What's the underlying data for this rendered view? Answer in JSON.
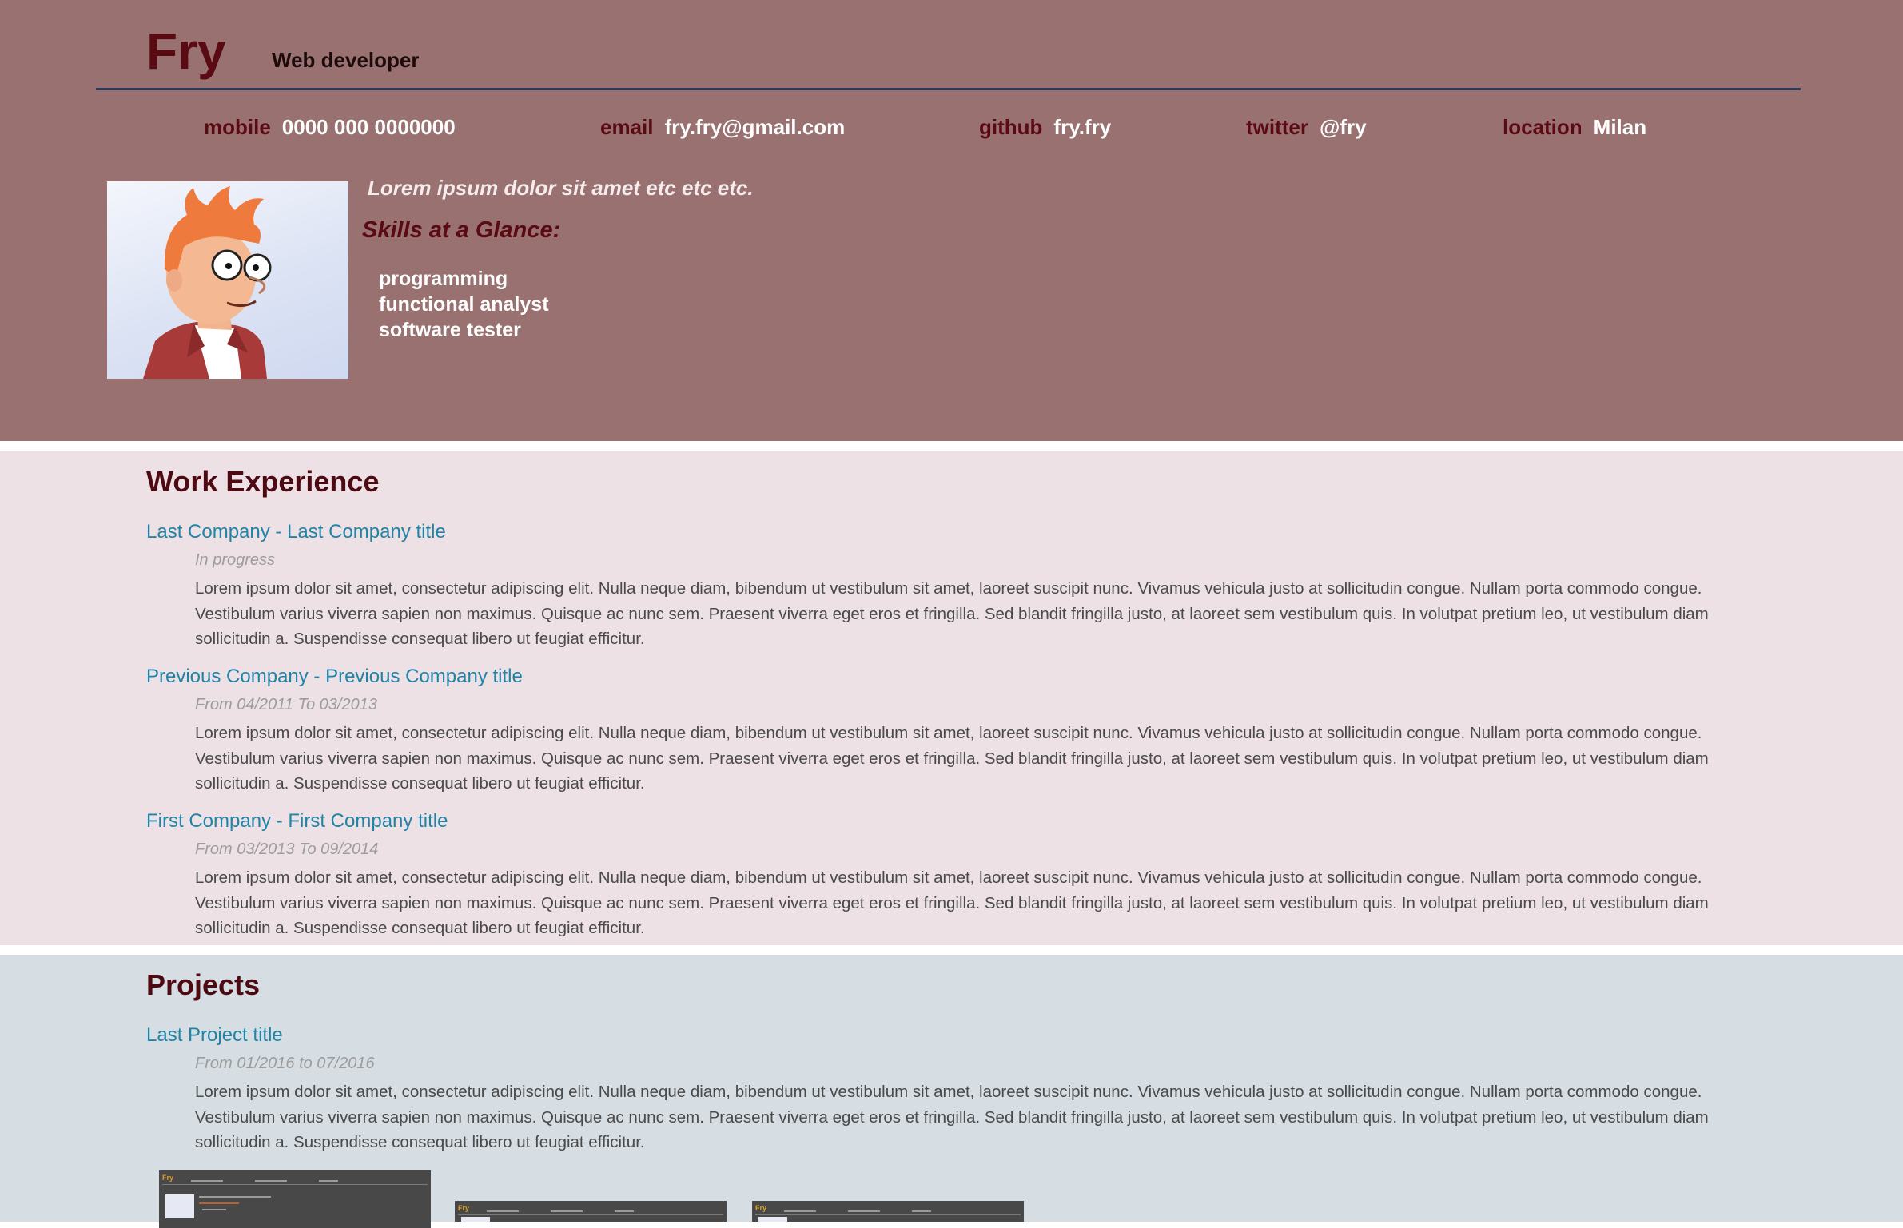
{
  "header": {
    "name": "Fry",
    "role": "Web developer",
    "contacts": [
      {
        "label": "mobile",
        "value": "0000 000 0000000"
      },
      {
        "label": "email",
        "value": "fry.fry@gmail.com"
      },
      {
        "label": "github",
        "value": "fry.fry"
      },
      {
        "label": "twitter",
        "value": "@fry"
      },
      {
        "label": "location",
        "value": "Milan"
      }
    ],
    "tagline": "Lorem ipsum dolor sit amet etc etc etc.",
    "skills_title": "Skills at a Glance:",
    "skills": [
      "programming",
      "functional analyst",
      "software tester"
    ]
  },
  "work": {
    "title": "Work Experience",
    "entries": [
      {
        "title": "Last Company - Last Company title",
        "date": "In progress",
        "description": "Lorem ipsum dolor sit amet, consectetur adipiscing elit. Nulla neque diam, bibendum ut vestibulum sit amet, laoreet suscipit nunc. Vivamus vehicula justo at sollicitudin congue. Nullam porta commodo congue. Vestibulum varius viverra sapien non maximus. Quisque ac nunc sem. Praesent viverra eget eros et fringilla. Sed blandit fringilla justo, at laoreet sem vestibulum quis. In volutpat pretium leo, ut vestibulum diam sollicitudin a. Suspendisse consequat libero ut feugiat efficitur."
      },
      {
        "title": "Previous Company - Previous Company title",
        "date": "From 04/2011 To 03/2013",
        "description": "Lorem ipsum dolor sit amet, consectetur adipiscing elit. Nulla neque diam, bibendum ut vestibulum sit amet, laoreet suscipit nunc. Vivamus vehicula justo at sollicitudin congue. Nullam porta commodo congue. Vestibulum varius viverra sapien non maximus. Quisque ac nunc sem. Praesent viverra eget eros et fringilla. Sed blandit fringilla justo, at laoreet sem vestibulum quis. In volutpat pretium leo, ut vestibulum diam sollicitudin a. Suspendisse consequat libero ut feugiat efficitur."
      },
      {
        "title": "First Company - First Company title",
        "date": "From 03/2013 To 09/2014",
        "description": "Lorem ipsum dolor sit amet, consectetur adipiscing elit. Nulla neque diam, bibendum ut vestibulum sit amet, laoreet suscipit nunc. Vivamus vehicula justo at sollicitudin congue. Nullam porta commodo congue. Vestibulum varius viverra sapien non maximus. Quisque ac nunc sem. Praesent viverra eget eros et fringilla. Sed blandit fringilla justo, at laoreet sem vestibulum quis. In volutpat pretium leo, ut vestibulum diam sollicitudin a. Suspendisse consequat libero ut feugiat efficitur."
      }
    ]
  },
  "projects": {
    "title": "Projects",
    "entries": [
      {
        "title": "Last Project title",
        "date": "From 01/2016 to 07/2016",
        "description": "Lorem ipsum dolor sit amet, consectetur adipiscing elit. Nulla neque diam, bibendum ut vestibulum sit amet, laoreet suscipit nunc. Vivamus vehicula justo at sollicitudin congue. Nullam porta commodo congue. Vestibulum varius viverra sapien non maximus. Quisque ac nunc sem. Praesent viverra eget eros et fringilla. Sed blandit fringilla justo, at laoreet sem vestibulum quis. In volutpat pretium leo, ut vestibulum diam sollicitudin a. Suspendisse consequat libero ut feugiat efficitur."
      }
    ]
  },
  "colors": {
    "header_bg": "#9a7171",
    "accent": "#5a0a12",
    "link": "#1f84a6",
    "work_bg": "#ede1e6",
    "projects_bg": "#d7dee3"
  },
  "icons": [
    "profile-photo-fry",
    "project-screenshot-thumbnail"
  ]
}
